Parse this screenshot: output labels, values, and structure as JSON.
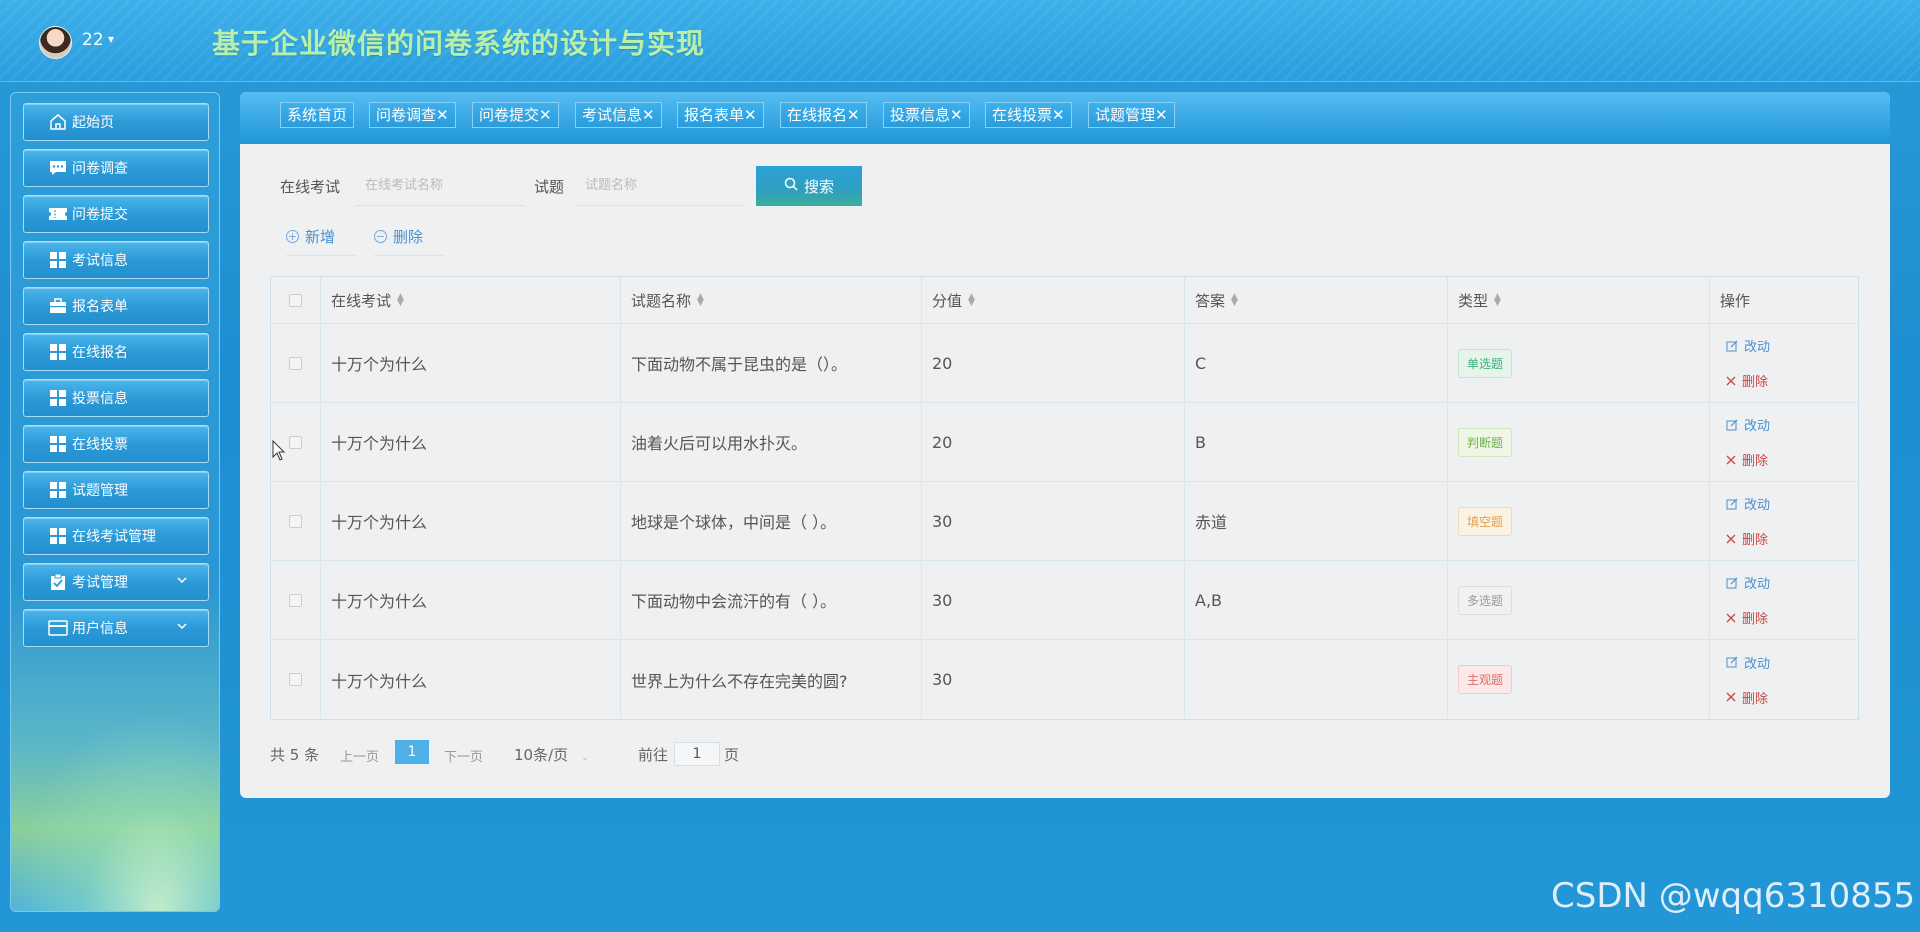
{
  "header": {
    "user_name": "22",
    "user_caret": "▾",
    "app_title": "基于企业微信的问卷系统的设计与实现"
  },
  "sidebar": {
    "items": [
      {
        "label": "起始页",
        "icon": "home-icon"
      },
      {
        "label": "问卷调查",
        "icon": "chat-icon"
      },
      {
        "label": "问卷提交",
        "icon": "ticket-icon"
      },
      {
        "label": "考试信息",
        "icon": "grid-icon"
      },
      {
        "label": "报名表单",
        "icon": "briefcase-icon"
      },
      {
        "label": "在线报名",
        "icon": "grid-icon"
      },
      {
        "label": "投票信息",
        "icon": "grid-icon"
      },
      {
        "label": "在线投票",
        "icon": "grid-icon"
      },
      {
        "label": "试题管理",
        "icon": "grid-icon"
      },
      {
        "label": "在线考试管理",
        "icon": "grid-icon"
      },
      {
        "label": "考试管理",
        "icon": "clipboard-icon",
        "expandable": true
      },
      {
        "label": "用户信息",
        "icon": "card-icon",
        "expandable": true
      }
    ]
  },
  "tabs": [
    {
      "label": "系统首页"
    },
    {
      "label": "问卷调查✕"
    },
    {
      "label": "问卷提交✕"
    },
    {
      "label": "考试信息✕"
    },
    {
      "label": "报名表单✕"
    },
    {
      "label": "在线报名✕"
    },
    {
      "label": "投票信息✕"
    },
    {
      "label": "在线投票✕"
    },
    {
      "label": "试题管理✕"
    }
  ],
  "search": {
    "exam_label": "在线考试",
    "exam_placeholder": "在线考试名称",
    "question_label": "试题",
    "question_placeholder": "试题名称",
    "search_button": "搜索"
  },
  "actions": {
    "add": "新增",
    "delete": "删除"
  },
  "table": {
    "columns": [
      "在线考试",
      "试题名称",
      "分值",
      "答案",
      "类型",
      "操作"
    ],
    "rows": [
      {
        "exam": "十万个为什么",
        "question": "下面动物不属于昆虫的是（）。",
        "score": "20",
        "answer": "C",
        "type": "单选题"
      },
      {
        "exam": "十万个为什么",
        "question": "油着火后可以用水扑灭。",
        "score": "20",
        "answer": "B",
        "type": "判断题"
      },
      {
        "exam": "十万个为什么",
        "question": "地球是个球体，中间是（ ）。",
        "score": "30",
        "answer": "赤道",
        "type": "填空题"
      },
      {
        "exam": "十万个为什么",
        "question": "下面动物中会流汗的有（ ）。",
        "score": "30",
        "answer": "A,B",
        "type": "多选题"
      },
      {
        "exam": "十万个为什么",
        "question": "世界上为什么不存在完美的圆?",
        "score": "30",
        "answer": "",
        "type": "主观题"
      }
    ],
    "edit_label": "改动",
    "delete_label": "删除"
  },
  "type_colors": {
    "单选题": {
      "fg": "#3fae7a",
      "bg": "#e6f5ec",
      "border": "#bfe6cf"
    },
    "判断题": {
      "fg": "#6fb04a",
      "bg": "#eef6e6",
      "border": "#cfe6bf"
    },
    "填空题": {
      "fg": "#e0a050",
      "bg": "#fbf2e4",
      "border": "#f0d9b5"
    },
    "多选题": {
      "fg": "#999999",
      "bg": "#f1f1f1",
      "border": "#dddddd"
    },
    "主观题": {
      "fg": "#e06a6a",
      "bg": "#fbe9e9",
      "border": "#f1c9c9"
    }
  },
  "pagination": {
    "total": "共 5 条",
    "prev": "上一页",
    "current": "1",
    "next": "下一页",
    "page_size": "10条/页",
    "goto_label": "前往",
    "goto_value": "1",
    "page_unit": "页"
  },
  "watermark": "CSDN @wqq6310855"
}
